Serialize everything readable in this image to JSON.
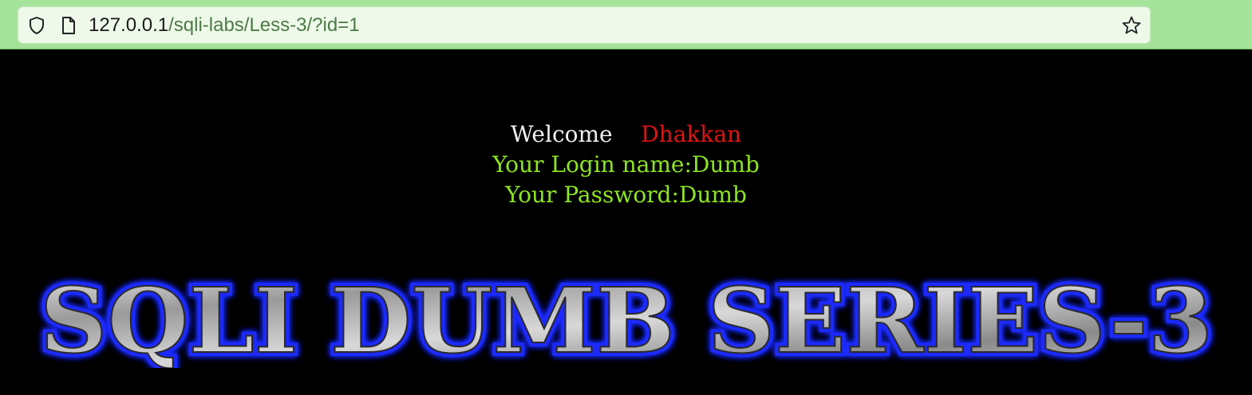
{
  "browser": {
    "url_host": "127.0.0.1",
    "url_path": "/sqli-labs/Less-3/?id=1"
  },
  "page": {
    "welcome_label": "Welcome",
    "welcome_name": "Dhakkan",
    "login_name_text": "Your Login name:Dumb",
    "password_text": "Your Password:Dumb",
    "banner_text": "SQLI DUMB SERIES-3"
  },
  "colors": {
    "background": "#000000",
    "welcome_name": "#e01414",
    "credentials": "#8ee51f",
    "toolbar": "#a6e39a",
    "banner_glow": "#1f2bff"
  }
}
